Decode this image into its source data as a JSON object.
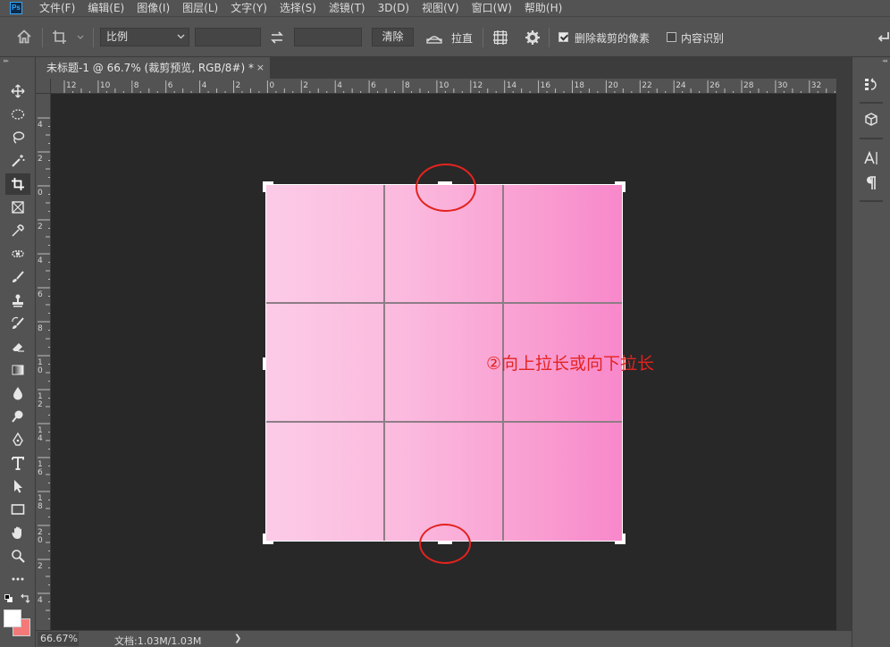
{
  "menubar": {
    "logo": "Ps",
    "items": [
      "文件(F)",
      "编辑(E)",
      "图像(I)",
      "图层(L)",
      "文字(Y)",
      "选择(S)",
      "滤镜(T)",
      "3D(D)",
      "视图(V)",
      "窗口(W)",
      "帮助(H)"
    ]
  },
  "options": {
    "ratio_value": "比例",
    "width_value": "",
    "height_value": "",
    "clear_label": "清除",
    "straighten_label": "拉直",
    "delete_cropped_label": "删除裁剪的像素",
    "delete_cropped_checked": true,
    "content_aware_label": "内容识别",
    "content_aware_checked": false
  },
  "tab": {
    "title": "未标题-1 @ 66.7% (裁剪预览, RGB/8#) *",
    "close": "×"
  },
  "rulers": {
    "top_labels": [
      "12",
      "10",
      "8",
      "6",
      "4",
      "2",
      "0",
      "2",
      "4",
      "6",
      "8",
      "10",
      "12",
      "14",
      "16",
      "18",
      "20",
      "22",
      "24",
      "26",
      "28",
      "30",
      "32"
    ],
    "left_labels": [
      "4",
      "2",
      "0",
      "2",
      "4",
      "6",
      "8",
      "1 0",
      "1 2",
      "1 4",
      "1 6",
      "1 8",
      "2 0",
      "2",
      "4"
    ]
  },
  "status": {
    "zoom": "66.67%",
    "doc_info": "文档:1.03M/1.03M",
    "arrow": "❯"
  },
  "annotation": {
    "text": "②向上拉长或向下拉长",
    "color": "#e3231f"
  },
  "colors": {
    "foreground": "#ffffff",
    "background": "#f47a7a",
    "gradient_left": "#fccbe6",
    "gradient_right": "#f888cb"
  }
}
